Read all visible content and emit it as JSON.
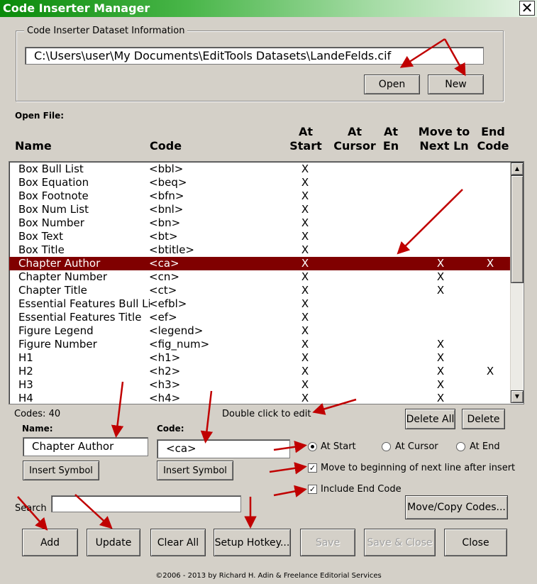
{
  "window": {
    "title": "Code Inserter Manager",
    "close_glyph": "✕"
  },
  "dataset": {
    "group_label": "Code Inserter Dataset Information",
    "path": "C:\\Users\\user\\My Documents\\EditTools Datasets\\LandeFelds.cif",
    "open_label": "Open",
    "new_label": "New"
  },
  "open_file_label": "Open File:",
  "columns": {
    "name": "Name",
    "code": "Code",
    "at_start": "At\nStart",
    "at_cursor": "At\nCursor",
    "at_end": "At\nEn",
    "move_next": "Move to\nNext Ln",
    "end_code": "End\nCode"
  },
  "rows": [
    {
      "name": "Box Bull List",
      "code": "<bbl>",
      "at_start": "X",
      "move_next": "",
      "end_code": ""
    },
    {
      "name": "Box Equation",
      "code": "<beq>",
      "at_start": "X",
      "move_next": "",
      "end_code": ""
    },
    {
      "name": "Box Footnote",
      "code": "<bfn>",
      "at_start": "X",
      "move_next": "",
      "end_code": ""
    },
    {
      "name": "Box Num List",
      "code": "<bnl>",
      "at_start": "X",
      "move_next": "",
      "end_code": ""
    },
    {
      "name": "Box Number",
      "code": "<bn>",
      "at_start": "X",
      "move_next": "",
      "end_code": ""
    },
    {
      "name": "Box Text",
      "code": "<bt>",
      "at_start": "X",
      "move_next": "",
      "end_code": ""
    },
    {
      "name": "Box Title",
      "code": "<btitle>",
      "at_start": "X",
      "move_next": "",
      "end_code": ""
    },
    {
      "name": "Chapter Author",
      "code": "<ca>",
      "at_start": "X",
      "move_next": "X",
      "end_code": "X",
      "selected": true
    },
    {
      "name": "Chapter Number",
      "code": "<cn>",
      "at_start": "X",
      "move_next": "X",
      "end_code": ""
    },
    {
      "name": "Chapter Title",
      "code": "<ct>",
      "at_start": "X",
      "move_next": "X",
      "end_code": ""
    },
    {
      "name": "Essential Features Bull List",
      "code": "<efbl>",
      "at_start": "X",
      "move_next": "",
      "end_code": ""
    },
    {
      "name": "Essential Features Title",
      "code": "<ef>",
      "at_start": "X",
      "move_next": "",
      "end_code": ""
    },
    {
      "name": "Figure Legend",
      "code": "<legend>",
      "at_start": "X",
      "move_next": "",
      "end_code": ""
    },
    {
      "name": "Figure Number",
      "code": "<fig_num>",
      "at_start": "X",
      "move_next": "X",
      "end_code": ""
    },
    {
      "name": "H1",
      "code": "<h1>",
      "at_start": "X",
      "move_next": "X",
      "end_code": ""
    },
    {
      "name": "H2",
      "code": "<h2>",
      "at_start": "X",
      "move_next": "X",
      "end_code": "X"
    },
    {
      "name": "H3",
      "code": "<h3>",
      "at_start": "X",
      "move_next": "X",
      "end_code": ""
    },
    {
      "name": "H4",
      "code": "<h4>",
      "at_start": "X",
      "move_next": "X",
      "end_code": ""
    }
  ],
  "codes_count": "Codes: 40",
  "hint": "Double click to edit",
  "delete_all_label": "Delete All",
  "delete_label": "Delete",
  "name_field": {
    "label": "Name:",
    "value": "Chapter Author",
    "insert_symbol": "Insert Symbol"
  },
  "code_field": {
    "label": "Code:",
    "value": "<ca>",
    "insert_symbol": "Insert Symbol"
  },
  "position_options": [
    {
      "label": "At Start",
      "checked": true
    },
    {
      "label": "At Cursor",
      "checked": false
    },
    {
      "label": "At End",
      "checked": false
    }
  ],
  "move_next_line": {
    "label": "Move to beginning of next line after insert",
    "checked": true
  },
  "include_end_code": {
    "label": "Include End Code",
    "checked": true
  },
  "move_copy_label": "Move/Copy Codes...",
  "search": {
    "label": "Search",
    "value": ""
  },
  "buttons": {
    "add": "Add",
    "update": "Update",
    "clear_all": "Clear All",
    "setup_hotkey": "Setup Hotkey...",
    "save": "Save",
    "save_close": "Save & Close",
    "close": "Close"
  },
  "copyright": "©2006 - 2013 by Richard H. Adin & Freelance Editorial Services",
  "colors": {
    "selection": "#800000",
    "arrow": "#c00000",
    "title_green": "#0a8a0a"
  }
}
